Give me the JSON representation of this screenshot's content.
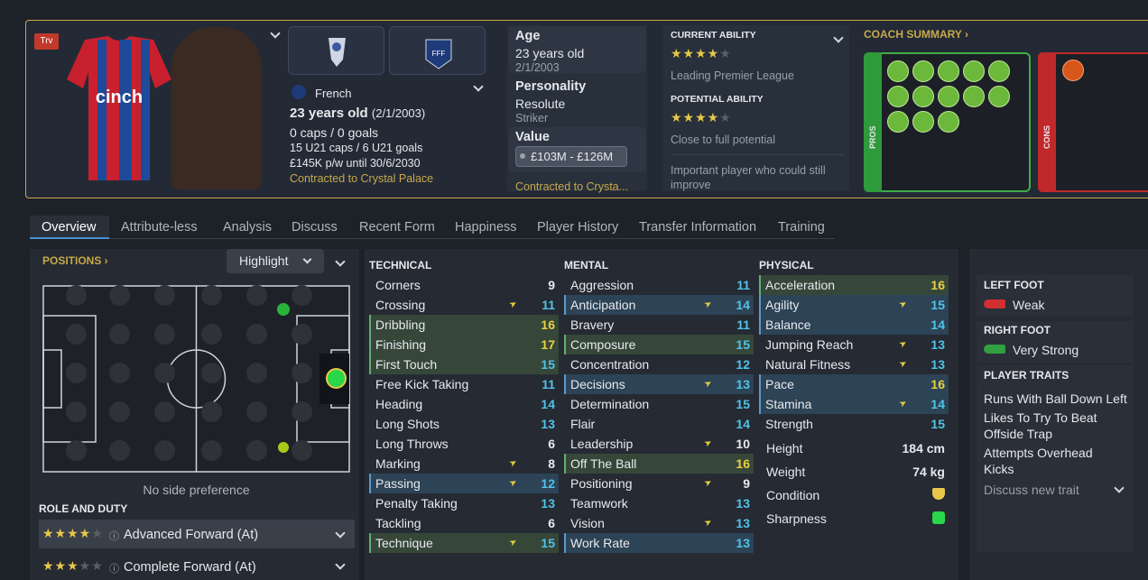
{
  "header": {
    "badge": "Trv",
    "nationality": "French",
    "age_line": "23 years old",
    "dob_paren": "(2/1/2003)",
    "caps": "0 caps / 0 goals",
    "u21": "15 U21 caps / 6 U21 goals",
    "wage": "£145K p/w until 30/6/2030",
    "contract": "Contracted to Crystal Palace"
  },
  "info": {
    "age_label": "Age",
    "age_value": "23 years old",
    "dob": "2/1/2003",
    "personality_label": "Personality",
    "personality_value": "Resolute",
    "position": "Striker",
    "value_label": "Value",
    "value_range": "£103M - £126M",
    "contract_short": "Contracted to Crysta..."
  },
  "ability": {
    "current_label": "CURRENT ABILITY",
    "current_text": "Leading Premier League",
    "current_stars": 4,
    "potential_label": "POTENTIAL ABILITY",
    "potential_text": "Close to full potential",
    "potential_stars": 4,
    "comment": "Important player who could still improve"
  },
  "coach": {
    "title": "COACH SUMMARY",
    "pros": "PROS",
    "cons": "CONS"
  },
  "tabs": [
    "Overview",
    "Attribute-less",
    "Analysis",
    "Discuss",
    "Recent Form",
    "Happiness",
    "Player History",
    "Transfer Information",
    "Training"
  ],
  "positions": {
    "title": "POSITIONS",
    "highlight": "Highlight",
    "side": "No side preference"
  },
  "role": {
    "title": "ROLE AND DUTY",
    "roles": [
      {
        "name": "Advanced Forward (At)",
        "stars": 4
      },
      {
        "name": "Complete Forward (At)",
        "stars": 3
      }
    ]
  },
  "technical": {
    "title": "TECHNICAL",
    "attrs": [
      {
        "n": "Corners",
        "v": "9"
      },
      {
        "n": "Crossing",
        "v": "11",
        "arrow": true
      },
      {
        "n": "Dribbling",
        "v": "16",
        "hl": "green"
      },
      {
        "n": "Finishing",
        "v": "17",
        "hl": "green"
      },
      {
        "n": "First Touch",
        "v": "15",
        "hl": "green"
      },
      {
        "n": "Free Kick Taking",
        "v": "11"
      },
      {
        "n": "Heading",
        "v": "14"
      },
      {
        "n": "Long Shots",
        "v": "13"
      },
      {
        "n": "Long Throws",
        "v": "6"
      },
      {
        "n": "Marking",
        "v": "8",
        "arrow": true
      },
      {
        "n": "Passing",
        "v": "12",
        "hl": "blue",
        "arrow": true
      },
      {
        "n": "Penalty Taking",
        "v": "13"
      },
      {
        "n": "Tackling",
        "v": "6"
      },
      {
        "n": "Technique",
        "v": "15",
        "hl": "green",
        "arrow": true
      }
    ]
  },
  "mental": {
    "title": "MENTAL",
    "attrs": [
      {
        "n": "Aggression",
        "v": "11"
      },
      {
        "n": "Anticipation",
        "v": "14",
        "hl": "blue",
        "arrow": true
      },
      {
        "n": "Bravery",
        "v": "11"
      },
      {
        "n": "Composure",
        "v": "15",
        "hl": "green"
      },
      {
        "n": "Concentration",
        "v": "12"
      },
      {
        "n": "Decisions",
        "v": "13",
        "hl": "blue",
        "arrow": true
      },
      {
        "n": "Determination",
        "v": "15"
      },
      {
        "n": "Flair",
        "v": "14"
      },
      {
        "n": "Leadership",
        "v": "10",
        "arrow": true
      },
      {
        "n": "Off The Ball",
        "v": "16",
        "hl": "green"
      },
      {
        "n": "Positioning",
        "v": "9",
        "arrow": true
      },
      {
        "n": "Teamwork",
        "v": "13"
      },
      {
        "n": "Vision",
        "v": "13",
        "arrow": true
      },
      {
        "n": "Work Rate",
        "v": "13",
        "hl": "blue"
      }
    ]
  },
  "physical": {
    "title": "PHYSICAL",
    "attrs": [
      {
        "n": "Acceleration",
        "v": "16",
        "hl": "green"
      },
      {
        "n": "Agility",
        "v": "15",
        "hl": "blue",
        "arrow": true
      },
      {
        "n": "Balance",
        "v": "14",
        "hl": "blue"
      },
      {
        "n": "Jumping Reach",
        "v": "13",
        "arrow": true
      },
      {
        "n": "Natural Fitness",
        "v": "13",
        "arrow": true
      },
      {
        "n": "Pace",
        "v": "16",
        "hl": "blue"
      },
      {
        "n": "Stamina",
        "v": "14",
        "hl": "blue",
        "arrow": true
      },
      {
        "n": "Strength",
        "v": "15"
      }
    ],
    "height_label": "Height",
    "height": "184 cm",
    "weight_label": "Weight",
    "weight": "74 kg",
    "condition_label": "Condition",
    "sharpness_label": "Sharpness"
  },
  "feet": {
    "left_title": "LEFT FOOT",
    "left": "Weak",
    "right_title": "RIGHT FOOT",
    "right": "Very Strong"
  },
  "traits": {
    "title": "PLAYER TRAITS",
    "items": [
      "Runs With Ball Down Left",
      "Likes To Try To Beat Offside Trap",
      "Attempts Overhead Kicks"
    ],
    "discuss": "Discuss new trait"
  },
  "colors": {
    "accent": "#c8a94a",
    "green_hl": "#36473a",
    "blue_hl": "#2d4356",
    "cyan": "#4fc3e8",
    "pros": "#2e9a3a",
    "cons": "#c0282a"
  }
}
